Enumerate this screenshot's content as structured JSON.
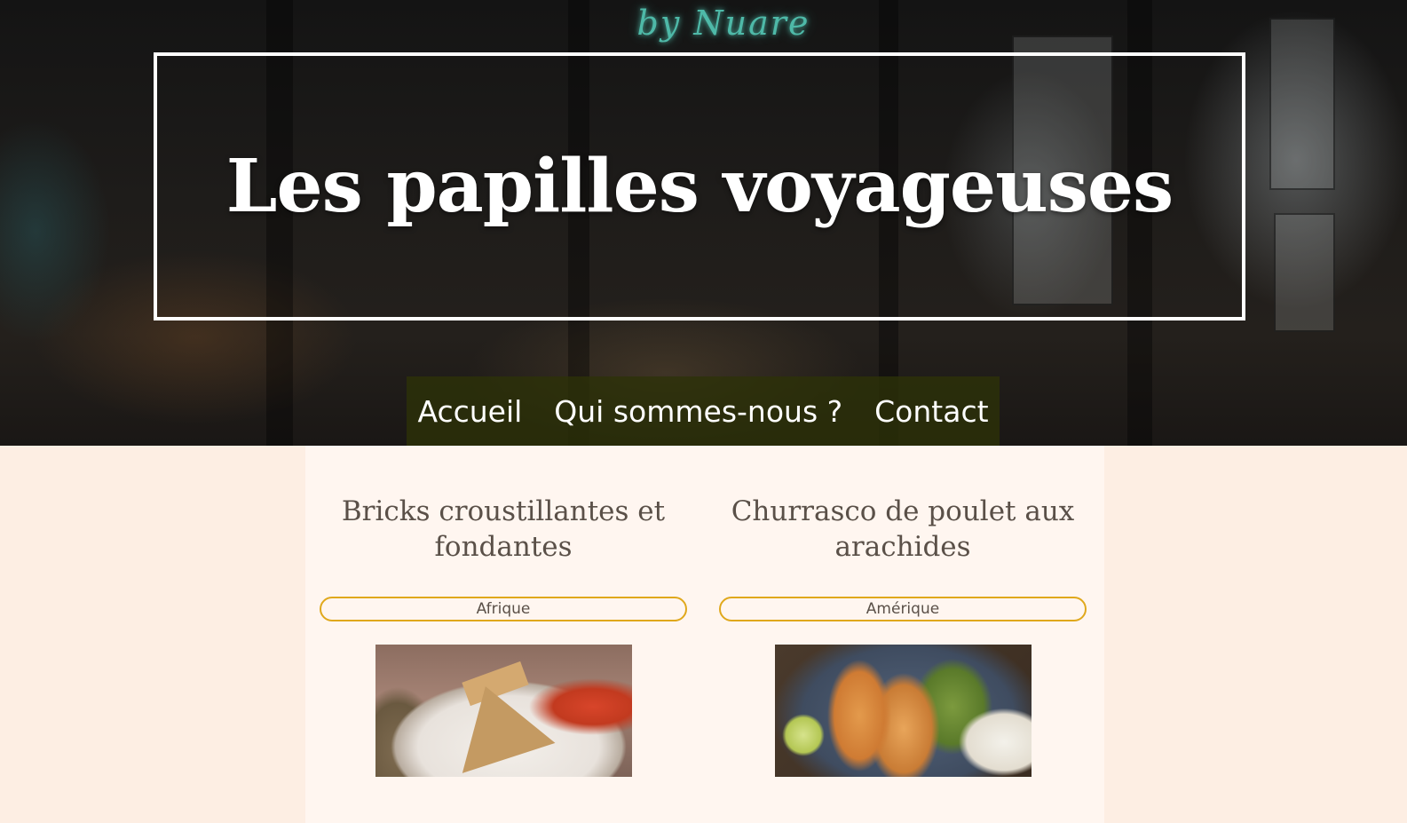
{
  "hero": {
    "neon_sign": "by Nuare",
    "title": "Les papilles voyageuses"
  },
  "nav": {
    "items": [
      {
        "label": "Accueil"
      },
      {
        "label": "Qui sommes-nous ?"
      },
      {
        "label": "Contact"
      }
    ]
  },
  "recipes": [
    {
      "title": "Bricks croustillantes et fondantes",
      "region": "Afrique",
      "image": "bricks-photo"
    },
    {
      "title": "Churrasco de poulet aux arachides",
      "region": "Amérique",
      "image": "churrasco-photo"
    }
  ],
  "colors": {
    "page_background": "#fdeee3",
    "content_background": "#fff6f0",
    "badge_border": "#e0a81c",
    "nav_background": "#2d3208",
    "heading_text": "#5a5048"
  }
}
